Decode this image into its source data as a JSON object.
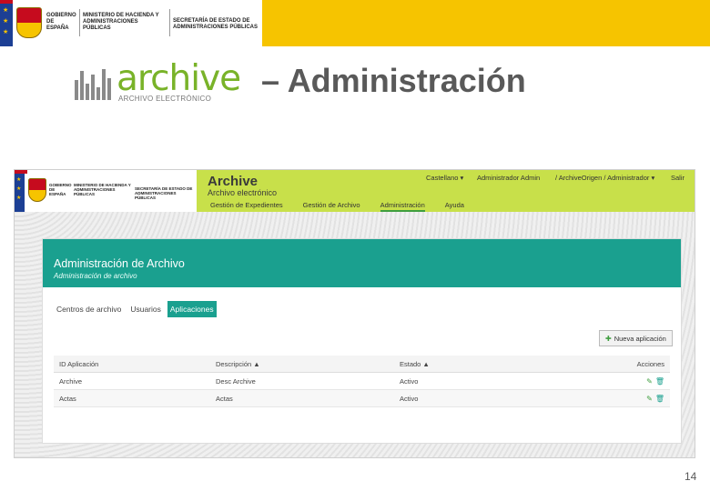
{
  "banner": {
    "gov_left": "GOBIERNO DE ESPAÑA",
    "ministry": "MINISTERIO DE HACIENDA Y ADMINISTRACIONES PÚBLICAS",
    "secretary": "SECRETARÍA DE ESTADO DE ADMINISTRACIONES PÚBLICAS"
  },
  "slide": {
    "logo_word": "archive",
    "logo_sub": "ARCHIVO ELECTRÓNICO",
    "title": "– Administración",
    "page_number": "14"
  },
  "app": {
    "title": "Archive",
    "subtitle": "Archivo electrónico",
    "top_menu": {
      "language": "Castellano ▾",
      "user": "Administrador Admin",
      "context": "/ ArchiveOrigen / Administrador ▾",
      "logout": "Salir"
    },
    "nav_tabs": [
      {
        "label": "Gestión de Expedientes"
      },
      {
        "label": "Gestión de Archivo"
      },
      {
        "label": "Administración"
      },
      {
        "label": "Ayuda"
      }
    ],
    "panel": {
      "title": "Administración de Archivo",
      "subtitle": "Administración de archivo"
    },
    "sub_tabs": [
      {
        "label": "Centros de archivo"
      },
      {
        "label": "Usuarios"
      },
      {
        "label": "Aplicaciones"
      }
    ],
    "new_button": "Nueva aplicación",
    "table": {
      "headers": [
        "ID Aplicación",
        "Descripción ▲",
        "Estado ▲",
        "Acciones"
      ],
      "rows": [
        {
          "id": "Archive",
          "description": "Desc Archive",
          "status": "Activo"
        },
        {
          "id": "Actas",
          "description": "Actas",
          "status": "Activo"
        }
      ]
    }
  },
  "colors": {
    "banner_yellow": "#f6c400",
    "archive_green": "#79b329",
    "app_header_lime": "#c8e04a",
    "panel_teal": "#1aa08f"
  }
}
